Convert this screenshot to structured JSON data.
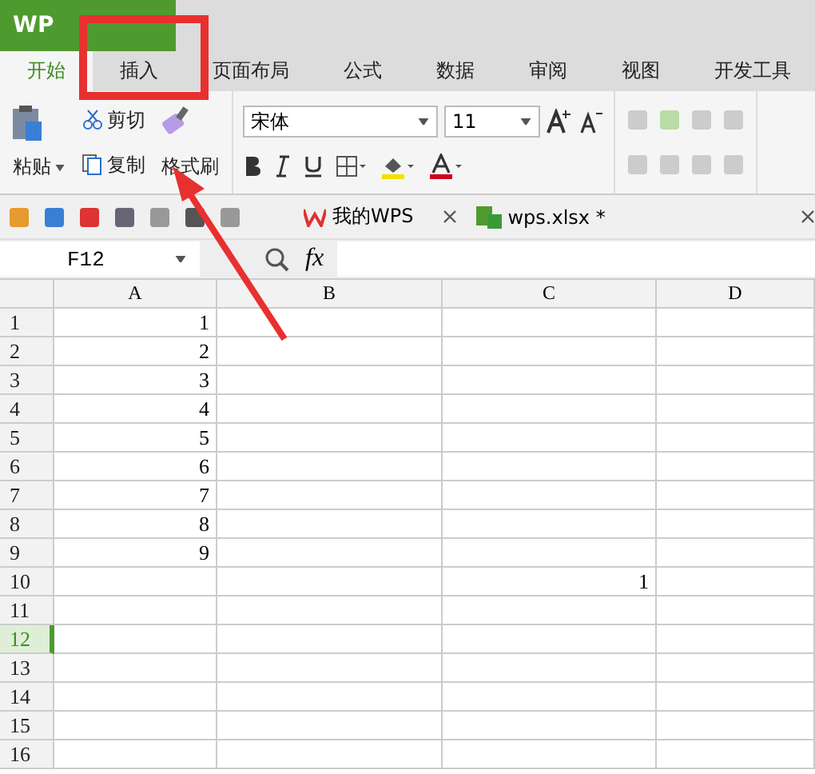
{
  "app_title": "WP",
  "ribbon_tabs": [
    {
      "label": "开始",
      "selected": true
    },
    {
      "label": "插入",
      "selected": false
    },
    {
      "label": "页面布局",
      "selected": false
    },
    {
      "label": "公式",
      "selected": false
    },
    {
      "label": "数据",
      "selected": false
    },
    {
      "label": "审阅",
      "selected": false
    },
    {
      "label": "视图",
      "selected": false
    },
    {
      "label": "开发工具",
      "selected": false
    }
  ],
  "clipboard": {
    "paste": "粘贴",
    "cut": "剪切",
    "copy": "复制",
    "format_painter": "格式刷"
  },
  "font": {
    "name": "宋体",
    "size": "11"
  },
  "doc_tabs": [
    {
      "label": "我的WPS",
      "kind": "home"
    },
    {
      "label": "wps.xlsx *",
      "kind": "sheet"
    }
  ],
  "name_box": "F12",
  "fx": "fx",
  "columns": [
    "A",
    "B",
    "C",
    "D"
  ],
  "rows": [
    {
      "header": "1",
      "selected": false,
      "cells": [
        "1",
        "",
        "",
        ""
      ]
    },
    {
      "header": "2",
      "selected": false,
      "cells": [
        "2",
        "",
        "",
        ""
      ]
    },
    {
      "header": "3",
      "selected": false,
      "cells": [
        "3",
        "",
        "",
        ""
      ]
    },
    {
      "header": "4",
      "selected": false,
      "cells": [
        "4",
        "",
        "",
        ""
      ]
    },
    {
      "header": "5",
      "selected": false,
      "cells": [
        "5",
        "",
        "",
        ""
      ]
    },
    {
      "header": "6",
      "selected": false,
      "cells": [
        "6",
        "",
        "",
        ""
      ]
    },
    {
      "header": "7",
      "selected": false,
      "cells": [
        "7",
        "",
        "",
        ""
      ]
    },
    {
      "header": "8",
      "selected": false,
      "cells": [
        "8",
        "",
        "",
        ""
      ]
    },
    {
      "header": "9",
      "selected": false,
      "cells": [
        "9",
        "",
        "",
        ""
      ]
    },
    {
      "header": "10",
      "selected": false,
      "cells": [
        "",
        "",
        "1",
        ""
      ]
    },
    {
      "header": "11",
      "selected": false,
      "cells": [
        "",
        "",
        "",
        ""
      ]
    },
    {
      "header": "12",
      "selected": true,
      "cells": [
        "",
        "",
        "",
        ""
      ]
    },
    {
      "header": "13",
      "selected": false,
      "cells": [
        "",
        "",
        "",
        ""
      ]
    },
    {
      "header": "14",
      "selected": false,
      "cells": [
        "",
        "",
        "",
        ""
      ]
    },
    {
      "header": "15",
      "selected": false,
      "cells": [
        "",
        "",
        "",
        ""
      ]
    },
    {
      "header": "16",
      "selected": false,
      "cells": [
        "",
        "",
        "",
        ""
      ]
    }
  ]
}
